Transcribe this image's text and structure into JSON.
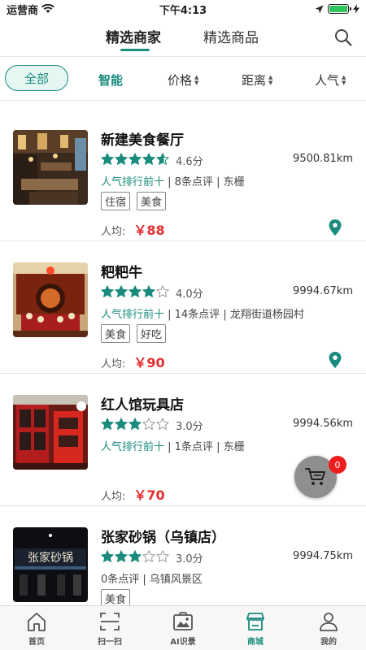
{
  "status_bar": {
    "carrier": "运营商",
    "time": "下午4:13"
  },
  "header": {
    "tabs": [
      {
        "label": "精选商家",
        "active": true
      },
      {
        "label": "精选商品",
        "active": false
      }
    ]
  },
  "filters": {
    "all": "全部",
    "smart": "智能",
    "price": "价格",
    "distance": "距离",
    "popularity": "人气"
  },
  "shops": [
    {
      "name": "新建美食餐厅",
      "rating": 4.6,
      "score_text": "4.6分",
      "distance": "9500.81km",
      "rank": "人气排行前十",
      "meta": " | 8条点评 | 东栅",
      "tags": [
        "住宿",
        "美食"
      ],
      "avg_label": "人均:",
      "price": "￥88"
    },
    {
      "name": "粑粑牛",
      "rating": 4.0,
      "score_text": "4.0分",
      "distance": "9994.67km",
      "rank": "人气排行前十",
      "meta": " | 14条点评 | 龙翔街道杨园村",
      "tags": [
        "美食",
        "好吃"
      ],
      "avg_label": "人均:",
      "price": "￥90"
    },
    {
      "name": "红人馆玩具店",
      "rating": 3.0,
      "score_text": "3.0分",
      "distance": "9994.56km",
      "rank": "人气排行前十",
      "meta": " | 1条点评 | 东栅",
      "tags": [],
      "avg_label": "人均:",
      "price": "￥70"
    },
    {
      "name": "张家砂锅（乌镇店）",
      "rating": 3.0,
      "score_text": "3.0分",
      "distance": "9994.75km",
      "rank": "",
      "meta": "0条点评 | 乌镇风景区",
      "tags": [
        "美食"
      ],
      "avg_label": "",
      "price": ""
    }
  ],
  "thumb_signboard": "张家砂锅",
  "cart": {
    "badge": "0"
  },
  "tabbar": {
    "items": [
      {
        "label": "首页",
        "icon": "home-icon"
      },
      {
        "label": "扫一扫",
        "icon": "scan-icon"
      },
      {
        "label": "AI识景",
        "icon": "ai-scene-icon"
      },
      {
        "label": "商城",
        "icon": "mall-icon",
        "active": true
      },
      {
        "label": "我的",
        "icon": "profile-icon"
      }
    ]
  },
  "colors": {
    "accent": "#1a8c7e",
    "price": "#e52f2f",
    "badge": "#f01d1d"
  }
}
